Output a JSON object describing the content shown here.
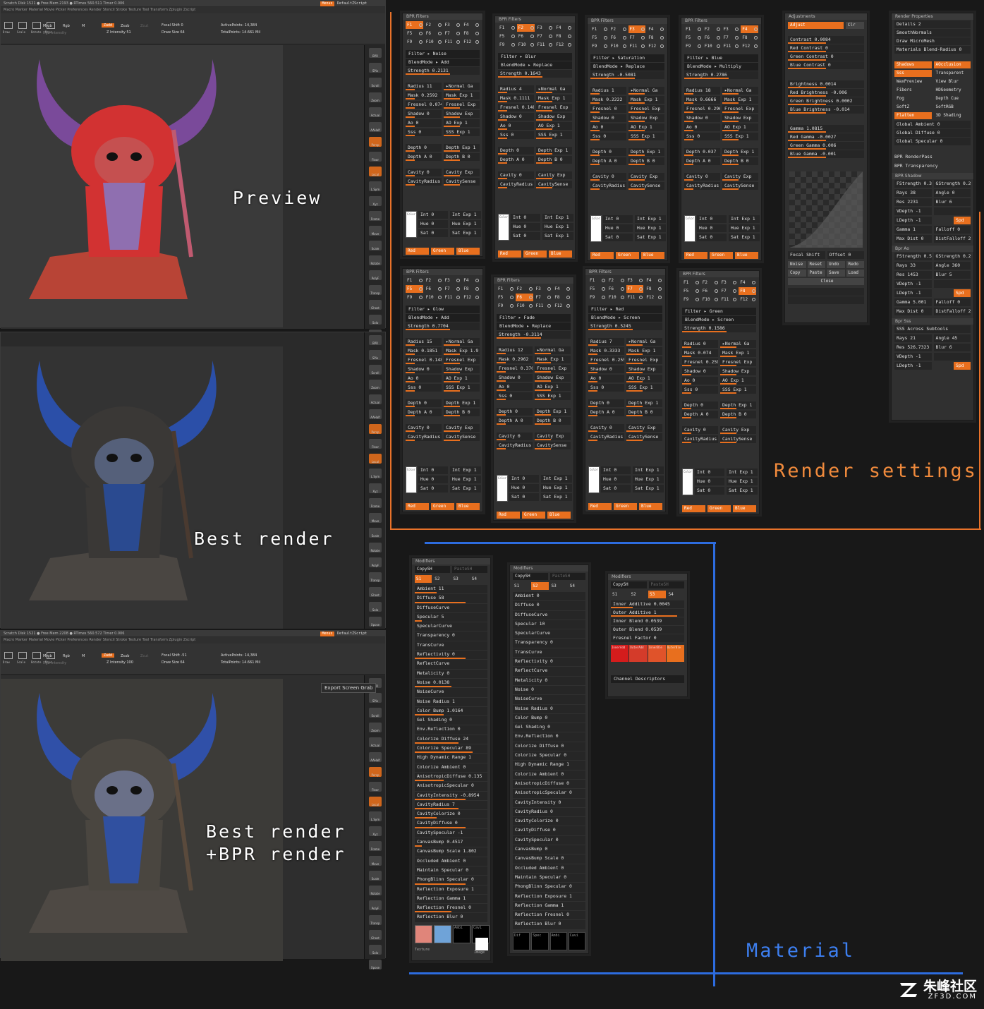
{
  "labels": {
    "preview": "Preview",
    "best_render": "Best render",
    "best_bpr_1": "Best render",
    "best_bpr_2": "+BPR render",
    "render_settings": "Render settings",
    "material": "Material"
  },
  "colors": {
    "accent": "#e86f1e",
    "frame": "#e8722a",
    "blue_line": "#2d6cdf",
    "label_orange": "#f08a3c",
    "label_blue": "#3d7ff0"
  },
  "viewport": {
    "status1": "Scratch Disk 1521 ● Free Mem 2193 ● RTimes 560.511 Timer 0.006",
    "status2": "Scratch Disk 1521 ● Free Mem 2208 ● RTimes 560.572 Timer 0.006",
    "menus_btn": "Menus",
    "script": "DefaultZScript",
    "menu_items": "Macro  Marker  Material  Movie  Picker  Preferences  Render  Stencil  Stroke  Texture  Tool  Transform  Zplugin  Zscript",
    "focal_shift_1": "Focal Shift 0",
    "focal_shift_2": "Focal Shift -51",
    "draw_size": "Draw Size 64",
    "z_intensity_1": "Z Intensity 51",
    "z_intensity_2": "Z Intensity 100",
    "active_points": "ActivePoints: 14,384",
    "total_points": "TotalPoints: 14.661 Mil",
    "mrgb": "Mrgb",
    "rgb": "Rgb",
    "m": "M",
    "zadd": "Zadd",
    "zsub": "Zsub",
    "zcut": "Zcut",
    "rgb_intensity": "Rgb Intensity",
    "export_btn": "Export Screen Grab",
    "tray": [
      "BPR",
      "SPix",
      "Scroll",
      "Zoom",
      "Actual",
      "AAHalf",
      "Persp",
      "Floor",
      "Local",
      "L.Sym",
      "Xyz",
      "Frame",
      "Move",
      "Scale",
      "Rotate",
      "PolyF",
      "Transp",
      "Ghost",
      "Solo",
      "Xpose"
    ],
    "tool_btns": [
      "Draw",
      "Scale",
      "Rotate",
      "Move"
    ]
  },
  "bpr_filters": [
    {
      "title": "BPR Filters",
      "sel": 0,
      "filter": "Filter ▸ Noise",
      "blend": "BlendMode ▸ Add",
      "strength": "Strength 0.2131",
      "radius": "Radius 11",
      "mask": "Mask 0.2592",
      "mask_exp": "Mask Exp 1",
      "fresnel": "Fresnel 0.074",
      "depth": "Depth 0",
      "depth_a": "Depth A 0",
      "depth_exp": "Depth Exp 1",
      "depth_b": "Depth B 0",
      "int": "Int 0",
      "hue": "Hue 0",
      "sat": "Sat 0"
    },
    {
      "title": "BPR Filters",
      "sel": 1,
      "filter": "Filter ▸ Blur",
      "blend": "BlendMode ▸ Replace",
      "strength": "Strength 0.1643",
      "radius": "Radius 4",
      "mask": "Mask 0.1111",
      "mask_exp": "Mask Exp 1",
      "fresnel": "Fresnel 0.148",
      "depth": "Depth 0",
      "depth_a": "Depth A 0",
      "depth_exp": "Depth Exp 1",
      "depth_b": "Depth B 0",
      "int": "Int 0",
      "hue": "Hue 0",
      "sat": "Sat 0"
    },
    {
      "title": "BPR Filters",
      "sel": 2,
      "filter": "Filter ▸ Saturation",
      "blend": "BlendMode ▸ Replace",
      "strength": "Strength -0.5081",
      "radius": "Radius 1",
      "mask": "Mask 0.2222",
      "mask_exp": "Mask Exp 1",
      "fresnel": "Fresnel 0",
      "depth": "Depth 0",
      "depth_a": "Depth A 0",
      "depth_exp": "Depth Exp 1",
      "depth_b": "Depth B 0",
      "int": "Int 0",
      "hue": "Hue 0",
      "sat": "Sat 0"
    },
    {
      "title": "BPR Filters",
      "sel": 3,
      "filter": "Filter ▸ Blue",
      "blend": "BlendMode ▸ Multiply",
      "strength": "Strength 0.2786",
      "radius": "Radius 18",
      "mask": "Mask 0.6666",
      "mask_exp": "Mask Exp 1",
      "fresnel": "Fresnel 0.296",
      "depth": "Depth 0.037",
      "depth_a": "Depth A 0",
      "depth_exp": "Depth Exp 1",
      "depth_b": "Depth B 0",
      "int": "Int 0",
      "hue": "Hue 0",
      "sat": "Sat 0"
    },
    {
      "title": "BPR Filters",
      "sel": 4,
      "filter": "Filter ▸ Glow",
      "blend": "BlendMode ▸ Add",
      "strength": "Strength 0.7704",
      "radius": "Radius 15",
      "mask": "Mask 0.1851",
      "mask_exp": "Mask Exp 1.9",
      "fresnel": "Fresnel 0.148",
      "depth": "Depth 0",
      "depth_a": "Depth A 0",
      "depth_exp": "Depth Exp 1",
      "depth_b": "Depth B 0",
      "int": "Int 0",
      "hue": "Hue 0",
      "sat": "Sat 0"
    },
    {
      "title": "BPR Filters",
      "sel": 5,
      "filter": "Filter ▸ Fade",
      "blend": "BlendMode ▸ Replace",
      "strength": "Strength -0.3114",
      "radius": "Radius 12",
      "mask": "Mask 0.2962",
      "mask_exp": "Mask Exp 1",
      "fresnel": "Fresnel 0.370",
      "depth": "Depth 0",
      "depth_a": "Depth A 0",
      "depth_exp": "Depth Exp 1",
      "depth_b": "Depth B 0",
      "int": "Int 0",
      "hue": "Hue 0",
      "sat": "Sat 0"
    },
    {
      "title": "BPR Filters",
      "sel": 6,
      "filter": "Filter ▸ Red",
      "blend": "BlendMode ▸ Screen",
      "strength": "Strength 0.5245",
      "radius": "Radius 7",
      "mask": "Mask 0.3333",
      "mask_exp": "Mask Exp 1",
      "fresnel": "Fresnel 0.255",
      "depth": "Depth 0",
      "depth_a": "Depth A 0",
      "depth_exp": "Depth Exp 1",
      "depth_b": "Depth B 0",
      "int": "Int 0",
      "hue": "Hue 0",
      "sat": "Sat 0"
    },
    {
      "title": "BPR Filters",
      "sel": 7,
      "filter": "Filter ▸ Green",
      "blend": "BlendMode ▸ Screen",
      "strength": "Strength 0.1586",
      "radius": "Radius 0",
      "mask": "Mask 0.074",
      "mask_exp": "Mask Exp 1",
      "fresnel": "Fresnel 0.259",
      "depth": "Depth 0",
      "depth_a": "Depth A 0",
      "depth_exp": "Depth Exp 1",
      "depth_b": "Depth B 0",
      "int": "Int 0",
      "hue": "Hue 0",
      "sat": "Sat 0"
    }
  ],
  "filter_common": {
    "f": [
      "F1",
      "F2",
      "F3",
      "F4",
      "F5",
      "F6",
      "F7",
      "F8",
      "F9",
      "F10",
      "F11",
      "F12"
    ],
    "normal": "▸Normal Ga",
    "fresnel_exp": "Fresnel Exp",
    "shadow": "Shadow 0",
    "shadow_exp": "Shadow Exp",
    "ao": "Ao 0",
    "ao_exp": "AO Exp 1",
    "sss": "Sss 0",
    "sss_exp": "SSS Exp 1",
    "cavity": "Cavity 0",
    "cavity_exp": "Cavity Exp",
    "cavity_radius": "CavityRadius",
    "cavity_sense": "CavitySense",
    "color": "Color",
    "int_exp": "Int Exp 1",
    "hue_exp": "Hue Exp 1",
    "sat_exp": "Sat Exp 1",
    "red": "Red",
    "green": "Green",
    "blue": "Blue"
  },
  "adjustments": {
    "title": "Adjustments",
    "adjust": "Adjust",
    "clr": "Clr",
    "rows1": [
      "Contrast 0.0084",
      "Red Contrast 0",
      "Green Contrast 0",
      "Blue Contrast 0"
    ],
    "rows2": [
      "Brightness 0.0014",
      "Red Brightness -0.006",
      "Green Brightness 0.0002",
      "Blue Brightness -0.014"
    ],
    "rows3": [
      "Gamma 1.0815",
      "Red Gamma -0.0027",
      "Green Gamma 0.006",
      "Blue Gamma -0.001"
    ],
    "focal": "Focal Shift",
    "offset": "Offset 0",
    "noise": "Noise",
    "reset": "Reset",
    "undo": "Undo",
    "redo": "Redo",
    "copy": "Copy",
    "paste": "Paste",
    "save": "Save",
    "load": "Load",
    "close": "Close"
  },
  "render_props": {
    "title": "Render Properties",
    "rows": [
      "Details 2",
      "SmoothNormals",
      "Draw MicroMesh",
      "Materials Blend-Radius 0"
    ],
    "pairs": [
      [
        "Shadows",
        "AOcclusion"
      ],
      [
        "Sss",
        "Transparent"
      ],
      [
        "WaxPreview",
        "View Blur"
      ],
      [
        "Fibers",
        "HDGeometry"
      ],
      [
        "Fog",
        "Depth Cue"
      ],
      [
        "SoftZ",
        "SoftRGB"
      ],
      [
        "Flatten",
        "3D Shading"
      ]
    ],
    "pair_on": [
      [
        true,
        true
      ],
      [
        true,
        false
      ],
      [
        false,
        false
      ],
      [
        false,
        false
      ],
      [
        false,
        false
      ],
      [
        false,
        false
      ],
      [
        true,
        false
      ]
    ],
    "globals": [
      "Global Ambient 0",
      "Global Diffuse 0",
      "Global Specular 0"
    ],
    "renderpass": "BPR RenderPass",
    "transparency": "BPR Transparency",
    "shadow_title": "BPR Shadow",
    "shadow": [
      [
        "FStrength 0.3",
        "GStrength 0.2"
      ],
      [
        "Rays 38",
        "Angle 0"
      ],
      [
        "Res 2231",
        "Blur 6"
      ],
      [
        "VDepth -1",
        ""
      ],
      [
        "LDepth -1",
        "Spd"
      ],
      [
        "Gamma 1",
        "Falloff 0"
      ],
      [
        "Max Dist 0",
        "DistFalloff 2"
      ]
    ],
    "ao_title": "Bpr Ao",
    "ao": [
      [
        "FStrength 0.5",
        "GStrength 0.2"
      ],
      [
        "Rays 33",
        "Angle 360"
      ],
      [
        "Res 1453",
        "Blur 5"
      ],
      [
        "VDepth -1",
        ""
      ],
      [
        "LDepth -1",
        "Spd"
      ],
      [
        "Gamma 5.001",
        "Falloff 0"
      ],
      [
        "Max Dist 0",
        "DistFalloff 2"
      ]
    ],
    "sss_title": "Bpr Sss",
    "sss_across": "SSS Across Subtools",
    "sss": [
      [
        "Rays 21",
        "Angle 45"
      ],
      [
        "Res 526.7323",
        "Blur 6"
      ],
      [
        "VDepth -1",
        ""
      ],
      [
        "LDepth -1",
        "Spd"
      ]
    ]
  },
  "modifiers1": {
    "title": "Modifiers",
    "copy": "CopySH",
    "paste": "PasteSH",
    "s": [
      "S1",
      "S2",
      "S3",
      "S4"
    ],
    "s_on": 0,
    "rows": [
      "Ambient 11",
      "Diffuse 58",
      "DiffuseCurve",
      "Specular 5",
      "SpecularCurve",
      "Transparency 0",
      "TransCurve",
      "Reflectivity 0",
      "ReflectCurve",
      "Metalicity 0",
      "Noise 0.0138",
      "NoiseCurve",
      "Noise Radius 1",
      "Color Bump 1.0164",
      "Gel Shading 0",
      "Env.Reflection 0",
      "Colorize Diffuse 24",
      "Colorize Specular 89",
      "High Dynamic Range 1",
      "Colorize Ambient 0",
      "AnisotropicDiffuse 0.135",
      "AnisotropicSpecular 0",
      "CavityIntensity -0.8954",
      "CavityRadius 7",
      "CavityColorize 0",
      "CavityDiffuse 0",
      "CavitySpecular -1",
      "CanvasBump 0.4517",
      "CanvasBump Scale 1.802",
      "Occluded Ambient 0",
      "Maintain Specular 0",
      "PhongBlinn Specular 0",
      "Reflection Exposure 1",
      "Reflection Gamma 1",
      "Reflection Fresnel 0",
      "Reflection Blur 0"
    ],
    "swatch_labels": [
      "Ambi",
      "Cavi"
    ],
    "texture": "Texture",
    "image": "Image"
  },
  "modifiers2": {
    "title": "Modifiers",
    "copy": "CopySH",
    "paste": "PasteSH",
    "s": [
      "S1",
      "S2",
      "S3",
      "S4"
    ],
    "s_on": 1,
    "rows": [
      "Ambient 0",
      "Diffuse 0",
      "DiffuseCurve",
      "Specular 10",
      "SpecularCurve",
      "Transparency 0",
      "TransCurve",
      "Reflectivity 0",
      "ReflectCurve",
      "Metalicity 0",
      "Noise 0",
      "NoiseCurve",
      "Noise Radius 0",
      "Color Bump 0",
      "Gel Shading 0",
      "Env.Reflection 0",
      "Colorize Diffuse 0",
      "Colorize Specular 0",
      "High Dynamic Range 1",
      "Colorize Ambient 0",
      "AnisotropicDiffuse 0",
      "AnisotropicSpecular 0",
      "CavityIntensity 0",
      "CavityRadius 0",
      "CavityColorize 0",
      "CavityDiffuse 0",
      "CavitySpecular 0",
      "CanvasBump 0",
      "CanvasBump Scale 0",
      "Occluded Ambient 0",
      "Maintain Specular 0",
      "PhongBlinn Specular 0",
      "Reflection Exposure 1",
      "Reflection Gamma 1",
      "Reflection Fresnel 0",
      "Reflection Blur 0"
    ],
    "swatch_labels": [
      "Dif",
      "Spec",
      "Ambi",
      "Cavi"
    ]
  },
  "modifiers3": {
    "title": "Modifiers",
    "copy": "CopySH",
    "paste": "PasteSH",
    "s": [
      "S1",
      "S2",
      "S3",
      "S4"
    ],
    "s_on": 2,
    "rows": [
      "Inner Additive 0.0045",
      "Outer Additive 1",
      "Inner Blend 0.0539",
      "Outer Blend 0.0539",
      "Fresnel Factor 0"
    ],
    "swatch_labels": [
      "InnerAdd",
      "OuterAdd",
      "InnerBle",
      "OuterBle"
    ],
    "channel": "Channel Descriptors"
  },
  "watermark": {
    "cn": "朱峰社区",
    "en": "ZF3D.COM"
  }
}
